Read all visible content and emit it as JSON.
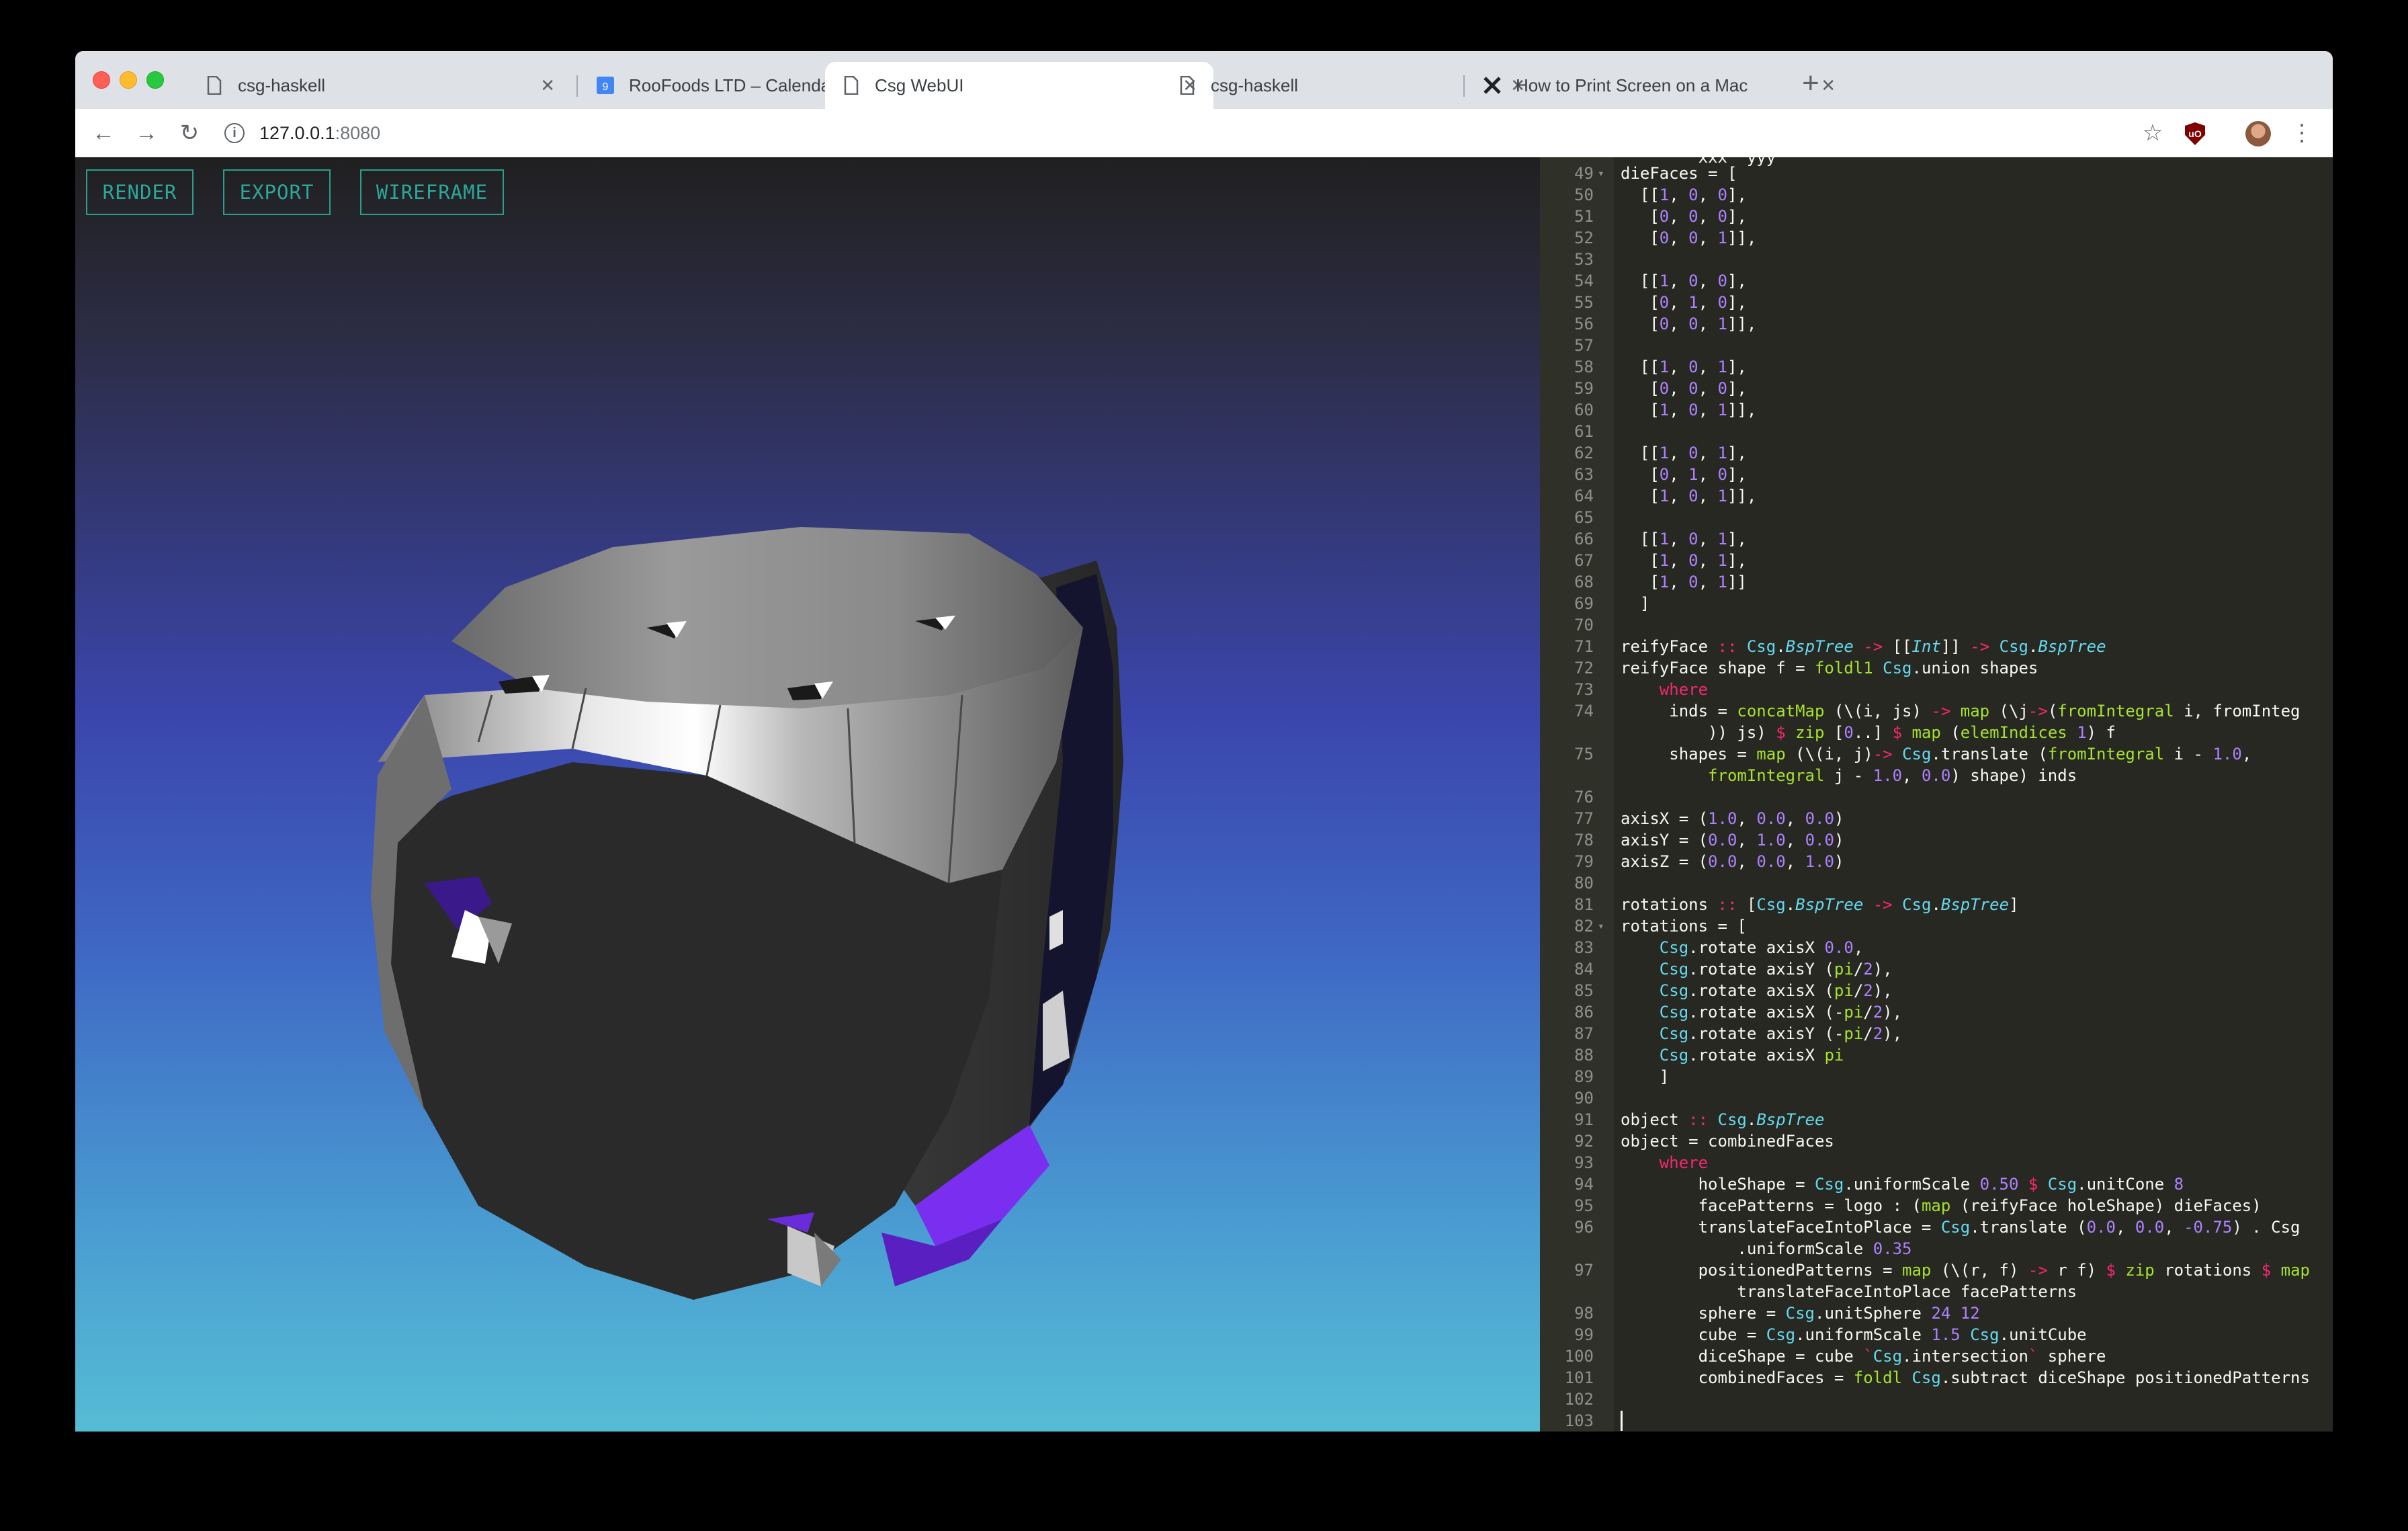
{
  "browser": {
    "tabs": [
      {
        "title": "csg-haskell",
        "icon": "page-icon",
        "active": false
      },
      {
        "title": "RooFoods LTD – Calendar - We",
        "icon": "calendar-icon",
        "active": false
      },
      {
        "title": "Csg WebUI",
        "icon": "page-icon",
        "active": true
      },
      {
        "title": "csg-haskell",
        "icon": "page-icon",
        "active": false
      },
      {
        "title": "How to Print Screen on a Mac",
        "icon": "x-logo-icon",
        "active": false
      }
    ],
    "calendar_badge": "9",
    "close_glyph": "✕",
    "new_tab_glyph": "+",
    "nav": {
      "back": "←",
      "forward": "→",
      "reload": "↻"
    },
    "address": {
      "host": "127.0.0.1",
      "port": ":8080",
      "info_glyph": "i"
    },
    "toolbar_glyphs": {
      "star": "☆",
      "menu": "⋮",
      "ublock": "uO"
    }
  },
  "viewer": {
    "buttons": {
      "render": "RENDER",
      "export": "EXPORT",
      "wireframe": "WIREFRAME"
    },
    "accent_color": "#2a9d8f"
  },
  "editor": {
    "partial_top_line": "xxx  yyy",
    "lines": [
      {
        "n": "49",
        "fold": "▾",
        "t": "dieFaces = ["
      },
      {
        "n": "50",
        "t": "  [[1, 0, 0],"
      },
      {
        "n": "51",
        "t": "   [0, 0, 0],"
      },
      {
        "n": "52",
        "t": "   [0, 0, 1]],"
      },
      {
        "n": "53",
        "t": ""
      },
      {
        "n": "54",
        "t": "  [[1, 0, 0],"
      },
      {
        "n": "55",
        "t": "   [0, 1, 0],"
      },
      {
        "n": "56",
        "t": "   [0, 0, 1]],"
      },
      {
        "n": "57",
        "t": ""
      },
      {
        "n": "58",
        "t": "  [[1, 0, 1],"
      },
      {
        "n": "59",
        "t": "   [0, 0, 0],"
      },
      {
        "n": "60",
        "t": "   [1, 0, 1]],"
      },
      {
        "n": "61",
        "t": ""
      },
      {
        "n": "62",
        "t": "  [[1, 0, 1],"
      },
      {
        "n": "63",
        "t": "   [0, 1, 0],"
      },
      {
        "n": "64",
        "t": "   [1, 0, 1]],"
      },
      {
        "n": "65",
        "t": ""
      },
      {
        "n": "66",
        "t": "  [[1, 0, 1],"
      },
      {
        "n": "67",
        "t": "   [1, 0, 1],"
      },
      {
        "n": "68",
        "t": "   [1, 0, 1]]"
      },
      {
        "n": "69",
        "t": "  ]"
      },
      {
        "n": "70",
        "t": ""
      },
      {
        "n": "71",
        "t": "reifyFace :: Csg.BspTree -> [[Int]] -> Csg.BspTree"
      },
      {
        "n": "72",
        "t": "reifyFace shape f = foldl1 Csg.union shapes"
      },
      {
        "n": "73",
        "t": "    where"
      },
      {
        "n": "74",
        "t": "     inds = concatMap (\\(i, js) -> map (\\j->(fromIntegral i, fromInteg"
      },
      {
        "n": "",
        "t": "         )) js) $ zip [0..] $ map (elemIndices 1) f"
      },
      {
        "n": "75",
        "t": "     shapes = map (\\(i, j)-> Csg.translate (fromIntegral i - 1.0,"
      },
      {
        "n": "",
        "t": "         fromIntegral j - 1.0, 0.0) shape) inds"
      },
      {
        "n": "76",
        "t": ""
      },
      {
        "n": "77",
        "t": "axisX = (1.0, 0.0, 0.0)"
      },
      {
        "n": "78",
        "t": "axisY = (0.0, 1.0, 0.0)"
      },
      {
        "n": "79",
        "t": "axisZ = (0.0, 0.0, 1.0)"
      },
      {
        "n": "80",
        "t": ""
      },
      {
        "n": "81",
        "t": "rotations :: [Csg.BspTree -> Csg.BspTree]"
      },
      {
        "n": "82",
        "fold": "▾",
        "t": "rotations = ["
      },
      {
        "n": "83",
        "t": "    Csg.rotate axisX 0.0,"
      },
      {
        "n": "84",
        "t": "    Csg.rotate axisY (pi/2),"
      },
      {
        "n": "85",
        "t": "    Csg.rotate axisX (pi/2),"
      },
      {
        "n": "86",
        "t": "    Csg.rotate axisX (-pi/2),"
      },
      {
        "n": "87",
        "t": "    Csg.rotate axisY (-pi/2),"
      },
      {
        "n": "88",
        "t": "    Csg.rotate axisX pi"
      },
      {
        "n": "89",
        "t": "    ]"
      },
      {
        "n": "90",
        "t": ""
      },
      {
        "n": "91",
        "t": "object :: Csg.BspTree"
      },
      {
        "n": "92",
        "t": "object = combinedFaces"
      },
      {
        "n": "93",
        "t": "    where"
      },
      {
        "n": "94",
        "t": "        holeShape = Csg.uniformScale 0.50 $ Csg.unitCone 8"
      },
      {
        "n": "95",
        "t": "        facePatterns = logo : (map (reifyFace holeShape) dieFaces)"
      },
      {
        "n": "96",
        "t": "        translateFaceIntoPlace = Csg.translate (0.0, 0.0, -0.75) . Csg"
      },
      {
        "n": "",
        "t": "            .uniformScale 0.35"
      },
      {
        "n": "97",
        "t": "        positionedPatterns = map (\\(r, f) -> r f) $ zip rotations $ map"
      },
      {
        "n": "",
        "t": "            translateFaceIntoPlace facePatterns"
      },
      {
        "n": "98",
        "t": "        sphere = Csg.unitSphere 24 12"
      },
      {
        "n": "99",
        "t": "        cube = Csg.uniformScale 1.5 Csg.unitCube"
      },
      {
        "n": "100",
        "t": "        diceShape = cube `Csg.intersection` sphere"
      },
      {
        "n": "101",
        "t": "        combinedFaces = foldl Csg.subtract diceShape positionedPatterns"
      },
      {
        "n": "102",
        "t": ""
      },
      {
        "n": "103",
        "t": ""
      }
    ]
  },
  "colors": {
    "editor_bg": "#272822",
    "keyword": "#f92672",
    "function": "#a6e22e",
    "type": "#66d9ef",
    "number": "#ae81ff",
    "accent_purple": "#7a2ff0"
  }
}
